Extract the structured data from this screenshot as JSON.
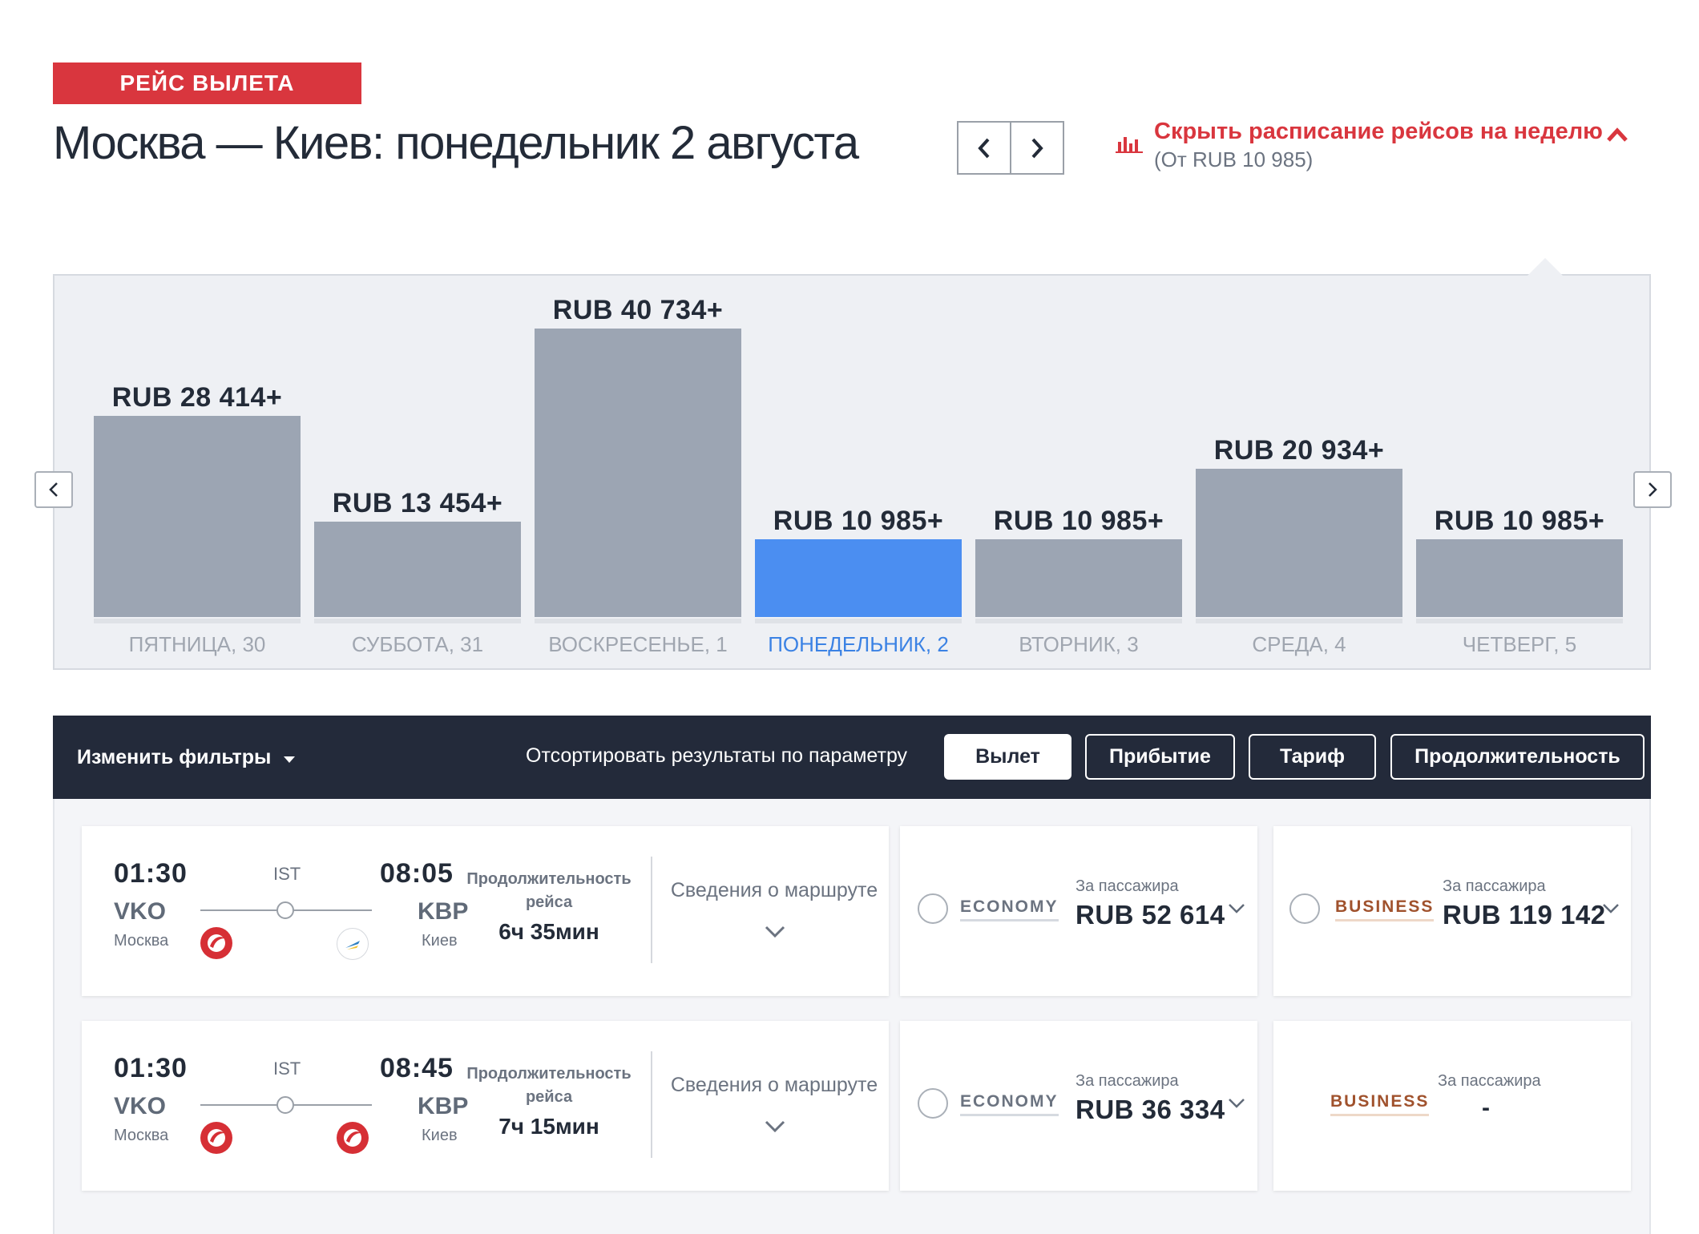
{
  "header": {
    "tag": "РЕЙС ВЫЛЕТА",
    "title": "Москва — Киев: понедельник 2 августа",
    "prev_symbol": "‹",
    "next_symbol": "›",
    "schedule_link": "Скрыть расписание рейсов на неделю",
    "schedule_from": "(От RUB 10 985)",
    "schedule_icon": "bar-chart-icon",
    "collapse_icon": "chevron-up-icon",
    "accent_color": "#d9363e"
  },
  "week": {
    "prev_arrow": "‹",
    "next_arrow": "›",
    "days": [
      {
        "label": "ПЯТНИЦА, 30",
        "price": "RUB 28 414+",
        "value": 28414,
        "selected": false
      },
      {
        "label": "СУББОТА, 31",
        "price": "RUB 13 454+",
        "value": 13454,
        "selected": false
      },
      {
        "label": "ВОСКРЕСЕНЬЕ, 1",
        "price": "RUB 40 734+",
        "value": 40734,
        "selected": false
      },
      {
        "label": "ПОНЕДЕЛЬНИК, 2",
        "price": "RUB 10 985+",
        "value": 10985,
        "selected": true
      },
      {
        "label": "ВТОРНИК, 3",
        "price": "RUB 10 985+",
        "value": 10985,
        "selected": false
      },
      {
        "label": "СРЕДА, 4",
        "price": "RUB 20 934+",
        "value": 20934,
        "selected": false
      },
      {
        "label": "ЧЕТВЕРГ, 5",
        "price": "RUB 10 985+",
        "value": 10985,
        "selected": false
      }
    ],
    "bar_color": "#9ca5b3",
    "selected_color": "#4b8ef1"
  },
  "filters": {
    "change_label": "Изменить фильтры",
    "sort_label": "Отсортировать результаты по параметру",
    "sort_buttons": [
      "Вылет",
      "Прибытие",
      "Тариф",
      "Продолжительность"
    ],
    "active_sort": "Вылет"
  },
  "flights": [
    {
      "dep_time": "01:30",
      "dep_code": "VKO",
      "dep_city": "Москва",
      "via": "IST",
      "arr_time": "08:05",
      "arr_code": "KBP",
      "arr_city": "Киев",
      "airline_icons": [
        "turkish-airlines-logo",
        "ukraine-international-logo"
      ],
      "duration_label": "Продолжительность рейса",
      "duration": "6ч 35мин",
      "details_label": "Сведения о маршруте",
      "economy": {
        "label": "ECONOMY",
        "per_pax": "За пассажира",
        "price": "RUB 52 614"
      },
      "business": {
        "label": "BUSINESS",
        "per_pax": "За пассажира",
        "price": "RUB 119 142"
      }
    },
    {
      "dep_time": "01:30",
      "dep_code": "VKO",
      "dep_city": "Москва",
      "via": "IST",
      "arr_time": "08:45",
      "arr_code": "KBP",
      "arr_city": "Киев",
      "airline_icons": [
        "turkish-airlines-logo",
        "turkish-airlines-logo"
      ],
      "duration_label": "Продолжительность рейса",
      "duration": "7ч 15мин",
      "details_label": "Сведения о маршруте",
      "economy": {
        "label": "ECONOMY",
        "per_pax": "За пассажира",
        "price": "RUB 36 334"
      },
      "business": {
        "label": "BUSINESS",
        "per_pax": "За пассажира",
        "price": "-"
      }
    }
  ]
}
